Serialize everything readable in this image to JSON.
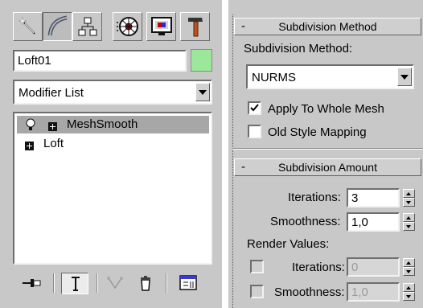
{
  "command_panel": {
    "tabs": [
      {
        "name": "create",
        "icon": "wand-star-icon",
        "active": false
      },
      {
        "name": "modify",
        "icon": "curve-arc-icon",
        "active": true
      },
      {
        "name": "hierarchy",
        "icon": "hierarchy-tree-icon",
        "active": false
      },
      {
        "name": "motion",
        "icon": "motion-wheel-icon",
        "active": false
      },
      {
        "name": "display",
        "icon": "monitor-display-icon",
        "active": false
      },
      {
        "name": "utilities",
        "icon": "hammer-icon",
        "active": false
      }
    ],
    "object_name": "Loft01",
    "object_color": "#9be89b",
    "modifier_list": {
      "selected": "Modifier List"
    },
    "stack": [
      {
        "label": "MeshSmooth",
        "selected": true,
        "icons": [
          "lightbulb-icon",
          "expand-plus-icon"
        ]
      },
      {
        "label": "Loft",
        "selected": false,
        "icons": [
          "expand-plus-icon"
        ]
      }
    ],
    "toolbar": [
      "pin-stack-icon",
      "show-end-result-icon",
      "make-unique-icon",
      "remove-modifier-icon",
      "configure-modifier-sets-icon"
    ]
  },
  "rollouts": {
    "subdivision_method": {
      "title": "Subdivision Method",
      "collapse_symbol": "-",
      "method_label": "Subdivision Method:",
      "method_value": "NURMS",
      "apply_whole_mesh": {
        "label": "Apply To Whole Mesh",
        "checked": true
      },
      "old_style_mapping": {
        "label": "Old Style Mapping",
        "checked": false
      }
    },
    "subdivision_amount": {
      "title": "Subdivision Amount",
      "collapse_symbol": "-",
      "iterations": {
        "label": "Iterations:",
        "value": "3"
      },
      "smoothness": {
        "label": "Smoothness:",
        "value": "1,0"
      },
      "render_values_label": "Render Values:",
      "render_iterations": {
        "label": "Iterations:",
        "value": "0",
        "enabled": false
      },
      "render_smoothness": {
        "label": "Smoothness:",
        "value": "1,0",
        "enabled": false
      }
    }
  }
}
